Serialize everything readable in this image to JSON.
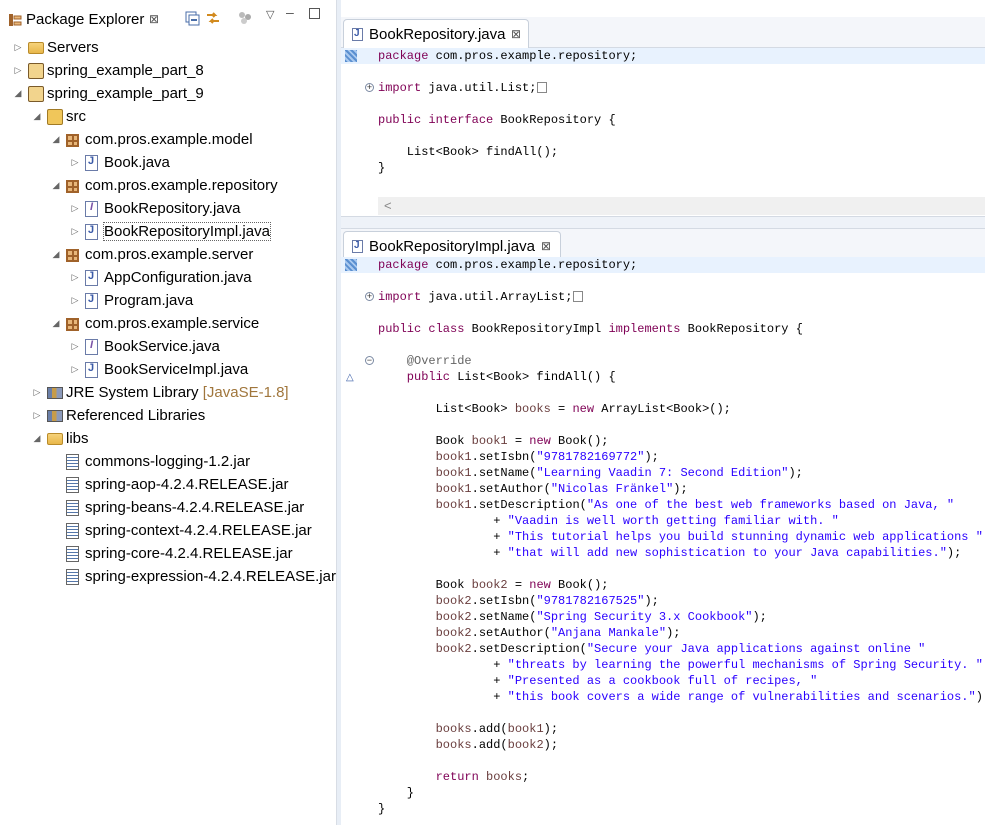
{
  "package_explorer": {
    "title": "Package Explorer",
    "close_glyph": "⊠",
    "toolbar_icons": [
      "collapse-all-icon",
      "link-with-editor-icon",
      "filters-icon",
      "view-menu-icon",
      "minimize-icon",
      "maximize-icon"
    ],
    "tree": [
      {
        "label": "Servers",
        "depth": 0,
        "expanded": false,
        "icon": "folder-icon"
      },
      {
        "label": "spring_example_part_8",
        "depth": 0,
        "expanded": false,
        "icon": "project-icon"
      },
      {
        "label": "spring_example_part_9",
        "depth": 0,
        "expanded": true,
        "icon": "project-icon"
      },
      {
        "label": "src",
        "depth": 1,
        "expanded": true,
        "icon": "source-folder-icon"
      },
      {
        "label": "com.pros.example.model",
        "depth": 2,
        "expanded": true,
        "icon": "package-icon"
      },
      {
        "label": "Book.java",
        "depth": 3,
        "expanded": false,
        "icon": "java-class-icon"
      },
      {
        "label": "com.pros.example.repository",
        "depth": 2,
        "expanded": true,
        "icon": "package-icon"
      },
      {
        "label": "BookRepository.java",
        "depth": 3,
        "expanded": false,
        "icon": "java-interface-icon"
      },
      {
        "label": "BookRepositoryImpl.java",
        "depth": 3,
        "expanded": false,
        "icon": "java-class-icon",
        "selected": true
      },
      {
        "label": "com.pros.example.server",
        "depth": 2,
        "expanded": true,
        "icon": "package-icon"
      },
      {
        "label": "AppConfiguration.java",
        "depth": 3,
        "expanded": false,
        "icon": "java-class-icon"
      },
      {
        "label": "Program.java",
        "depth": 3,
        "expanded": false,
        "icon": "java-class-icon"
      },
      {
        "label": "com.pros.example.service",
        "depth": 2,
        "expanded": true,
        "icon": "package-icon"
      },
      {
        "label": "BookService.java",
        "depth": 3,
        "expanded": false,
        "icon": "java-interface-icon"
      },
      {
        "label": "BookServiceImpl.java",
        "depth": 3,
        "expanded": false,
        "icon": "java-class-icon"
      },
      {
        "label": "JRE System Library",
        "decoration": "[JavaSE-1.8]",
        "depth": 1,
        "expanded": false,
        "icon": "library-icon"
      },
      {
        "label": "Referenced Libraries",
        "depth": 1,
        "expanded": false,
        "icon": "library-icon"
      },
      {
        "label": "libs",
        "depth": 1,
        "expanded": true,
        "icon": "folder-icon"
      },
      {
        "label": "commons-logging-1.2.jar",
        "depth": 2,
        "leaf": true,
        "icon": "jar-icon"
      },
      {
        "label": "spring-aop-4.2.4.RELEASE.jar",
        "depth": 2,
        "leaf": true,
        "icon": "jar-icon"
      },
      {
        "label": "spring-beans-4.2.4.RELEASE.jar",
        "depth": 2,
        "leaf": true,
        "icon": "jar-icon"
      },
      {
        "label": "spring-context-4.2.4.RELEASE.jar",
        "depth": 2,
        "leaf": true,
        "icon": "jar-icon"
      },
      {
        "label": "spring-core-4.2.4.RELEASE.jar",
        "depth": 2,
        "leaf": true,
        "icon": "jar-icon"
      },
      {
        "label": "spring-expression-4.2.4.RELEASE.jar",
        "depth": 2,
        "leaf": true,
        "icon": "jar-icon"
      }
    ]
  },
  "editor_top": {
    "tab_label": "BookRepository.java",
    "close_glyph": "⊠",
    "lines": [
      [
        [
          "kw",
          "package"
        ],
        [
          "t",
          " com.pros.example.repository;"
        ]
      ],
      [],
      [
        [
          "kw",
          "import"
        ],
        [
          "t",
          " java.util.List;"
        ],
        [
          "box",
          ""
        ]
      ],
      [],
      [
        [
          "kw",
          "public interface"
        ],
        [
          "t",
          " BookRepository {"
        ]
      ],
      [],
      [
        [
          "t",
          "    List<Book> findAll();"
        ]
      ],
      [
        [
          "t",
          "}"
        ]
      ]
    ],
    "scroll_glyph": "<"
  },
  "editor_bottom": {
    "tab_label": "BookRepositoryImpl.java",
    "close_glyph": "⊠",
    "lines": [
      [
        [
          "kw",
          "package"
        ],
        [
          "t",
          " com.pros.example.repository;"
        ]
      ],
      [],
      [
        [
          "kw",
          "import"
        ],
        [
          "t",
          " java.util.ArrayList;"
        ],
        [
          "box",
          ""
        ]
      ],
      [],
      [
        [
          "kw",
          "public class"
        ],
        [
          "t",
          " BookRepositoryImpl "
        ],
        [
          "kw",
          "implements"
        ],
        [
          "t",
          " BookRepository {"
        ]
      ],
      [],
      [
        [
          "ann",
          "    @Override"
        ]
      ],
      [
        [
          "kw",
          "    public"
        ],
        [
          "t",
          " List<Book> findAll() {"
        ]
      ],
      [],
      [
        [
          "t",
          "        List<Book> "
        ],
        [
          "fld",
          "books"
        ],
        [
          "t",
          " = "
        ],
        [
          "kw",
          "new"
        ],
        [
          "t",
          " ArrayList<Book>();"
        ]
      ],
      [],
      [
        [
          "t",
          "        Book "
        ],
        [
          "fld",
          "book1"
        ],
        [
          "t",
          " = "
        ],
        [
          "kw",
          "new"
        ],
        [
          "t",
          " Book();"
        ]
      ],
      [
        [
          "fld",
          "        book1"
        ],
        [
          "t",
          ".setIsbn("
        ],
        [
          "str",
          "\"9781782169772\""
        ],
        [
          "t",
          ");"
        ]
      ],
      [
        [
          "fld",
          "        book1"
        ],
        [
          "t",
          ".setName("
        ],
        [
          "str",
          "\"Learning Vaadin 7: Second Edition\""
        ],
        [
          "t",
          ");"
        ]
      ],
      [
        [
          "fld",
          "        book1"
        ],
        [
          "t",
          ".setAuthor("
        ],
        [
          "str",
          "\"Nicolas Fränkel\""
        ],
        [
          "t",
          ");"
        ]
      ],
      [
        [
          "fld",
          "        book1"
        ],
        [
          "t",
          ".setDescription("
        ],
        [
          "str",
          "\"As one of the best web frameworks based on Java, \""
        ]
      ],
      [
        [
          "t",
          "                + "
        ],
        [
          "str",
          "\"Vaadin is well worth getting familiar with. \""
        ]
      ],
      [
        [
          "t",
          "                + "
        ],
        [
          "str",
          "\"This tutorial helps you build stunning dynamic web applications \""
        ]
      ],
      [
        [
          "t",
          "                + "
        ],
        [
          "str",
          "\"that will add new sophistication to your Java capabilities.\""
        ],
        [
          "t",
          ");"
        ]
      ],
      [],
      [
        [
          "t",
          "        Book "
        ],
        [
          "fld",
          "book2"
        ],
        [
          "t",
          " = "
        ],
        [
          "kw",
          "new"
        ],
        [
          "t",
          " Book();"
        ]
      ],
      [
        [
          "fld",
          "        book2"
        ],
        [
          "t",
          ".setIsbn("
        ],
        [
          "str",
          "\"9781782167525\""
        ],
        [
          "t",
          ");"
        ]
      ],
      [
        [
          "fld",
          "        book2"
        ],
        [
          "t",
          ".setName("
        ],
        [
          "str",
          "\"Spring Security 3.x Cookbook\""
        ],
        [
          "t",
          ");"
        ]
      ],
      [
        [
          "fld",
          "        book2"
        ],
        [
          "t",
          ".setAuthor("
        ],
        [
          "str",
          "\"Anjana Mankale\""
        ],
        [
          "t",
          ");"
        ]
      ],
      [
        [
          "fld",
          "        book2"
        ],
        [
          "t",
          ".setDescription("
        ],
        [
          "str",
          "\"Secure your Java applications against online \""
        ]
      ],
      [
        [
          "t",
          "                + "
        ],
        [
          "str",
          "\"threats by learning the powerful mechanisms of Spring Security. \""
        ]
      ],
      [
        [
          "t",
          "                + "
        ],
        [
          "str",
          "\"Presented as a cookbook full of recipes, \""
        ]
      ],
      [
        [
          "t",
          "                + "
        ],
        [
          "str",
          "\"this book covers a wide range of vulnerabilities and scenarios.\""
        ],
        [
          "t",
          ");"
        ]
      ],
      [],
      [
        [
          "fld",
          "        books"
        ],
        [
          "t",
          ".add("
        ],
        [
          "fld",
          "book1"
        ],
        [
          "t",
          ");"
        ]
      ],
      [
        [
          "fld",
          "        books"
        ],
        [
          "t",
          ".add("
        ],
        [
          "fld",
          "book2"
        ],
        [
          "t",
          ");"
        ]
      ],
      [],
      [
        [
          "kw",
          "        return"
        ],
        [
          "t",
          " "
        ],
        [
          "fld",
          "books"
        ],
        [
          "t",
          ";"
        ]
      ],
      [
        [
          "t",
          "    }"
        ]
      ],
      [
        [
          "t",
          "}"
        ]
      ]
    ]
  }
}
